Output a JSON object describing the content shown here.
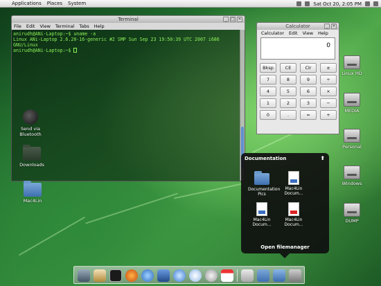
{
  "top_panel": {
    "menus": [
      "Applications",
      "Places",
      "System"
    ],
    "clock": "Sat Oct 20,  2:05 PM"
  },
  "terminal": {
    "title": "Terminal",
    "menu": [
      "File",
      "Edit",
      "View",
      "Terminal",
      "Tabs",
      "Help"
    ],
    "lines": [
      "anirudh@ANi-Laptop:~$ uname -a",
      "Linux ANi-Laptop 2.6.20-16-generic #2 SMP Sun Sep 23 19:50:39 UTC 2007 i686",
      "GNU/Linux",
      "anirudh@ANi-Laptop:~$ "
    ]
  },
  "calculator": {
    "title": "Calculator",
    "menu": [
      "Calculator",
      "Edit",
      "View",
      "Help"
    ],
    "display": "0",
    "keys": [
      "Bksp",
      "CE",
      "Clr",
      "±",
      "7",
      "8",
      "9",
      "÷",
      "4",
      "5",
      "6",
      "×",
      "1",
      "2",
      "3",
      "−",
      "0",
      ".",
      "=",
      "+"
    ]
  },
  "desktop_icons_left": [
    {
      "label": "Send via Bluetooth",
      "icon": "bluetooth-icon"
    },
    {
      "label": "Downloads",
      "icon": "folder-icon"
    },
    {
      "label": "Mac4Lin",
      "icon": "folder-icon"
    }
  ],
  "desktop_icons_right": [
    {
      "label": "Linux HD",
      "icon": "harddisk-icon"
    },
    {
      "label": "MEDIA",
      "icon": "harddisk-icon"
    },
    {
      "label": "Personal",
      "icon": "harddisk-icon"
    },
    {
      "label": "Windows",
      "icon": "harddisk-icon"
    },
    {
      "label": "DUMP",
      "icon": "harddisk-icon"
    }
  ],
  "stack": {
    "title": "Documentation",
    "items": [
      {
        "label": "Documentation Pics",
        "icon": "folder-icon"
      },
      {
        "label": "Mac4Lin Docum...",
        "icon": "document-icon"
      },
      {
        "label": "Mac4Lin Docum...",
        "icon": "document-icon"
      },
      {
        "label": "Mac4Lin Docum...",
        "icon": "pdf-icon"
      }
    ],
    "footer": "Open filemanager"
  },
  "dock": {
    "icons": [
      "system-icon",
      "home-icon",
      "terminal-icon",
      "firefox-icon",
      "chat-icon",
      "photos-icon",
      "globe-icon",
      "music-icon",
      "clock-icon",
      "calendar-icon",
      "trash-icon",
      "folder-icon",
      "documents-stack-icon",
      "trash-can-icon"
    ]
  },
  "colors": {
    "terminal_text": "#8ef25a",
    "scroll_thumb": "#5f8fd0",
    "stack_bg": "#0f0f0f"
  }
}
